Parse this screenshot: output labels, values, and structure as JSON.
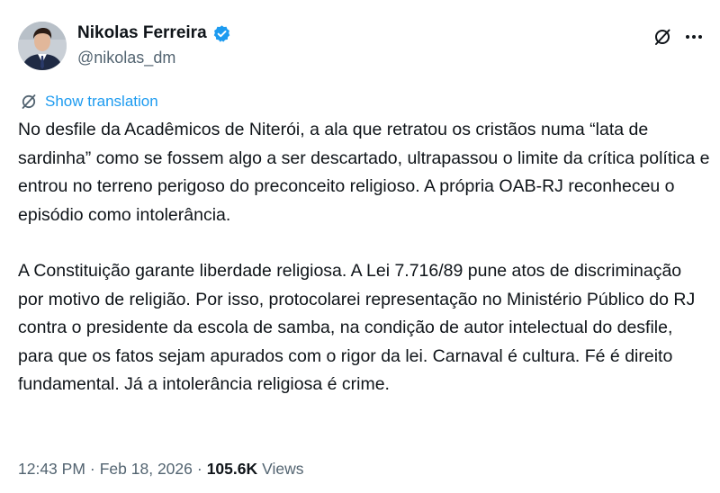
{
  "author": {
    "display_name": "Nikolas Ferreira",
    "handle": "@nikolas_dm",
    "verified": true,
    "verified_color": "#1d9bf0"
  },
  "header_actions": {
    "grok_icon": "grok-icon",
    "more_icon": "more-horizontal-icon"
  },
  "translate": {
    "label": "Show translation",
    "icon": "translate-icon",
    "color": "#1d9bf0"
  },
  "tweet": {
    "paragraphs": [
      "No desfile da Acadêmicos de Niterói, a ala que retratou os cristãos numa “lata de sardinha” como se fossem algo a ser descartado, ultrapassou o limite da crítica política e entrou no terreno perigoso do preconceito religioso. A própria OAB-RJ reconheceu o episódio como intolerância.",
      "A Constituição garante liberdade religiosa. A Lei 7.716/89 pune atos de discriminação por motivo de religião. Por isso, protocolarei representação no Ministério Público do RJ contra o presidente da escola de samba, na condição de autor intelectual do desfile, para que os fatos sejam apurados com o rigor da lei. Carnaval é cultura. Fé é direito fundamental. Já a intolerância religiosa é crime."
    ]
  },
  "meta": {
    "time": "12:43 PM",
    "separator": "·",
    "date": "Feb 18, 2026",
    "views_count": "105.6K",
    "views_label": "Views"
  }
}
